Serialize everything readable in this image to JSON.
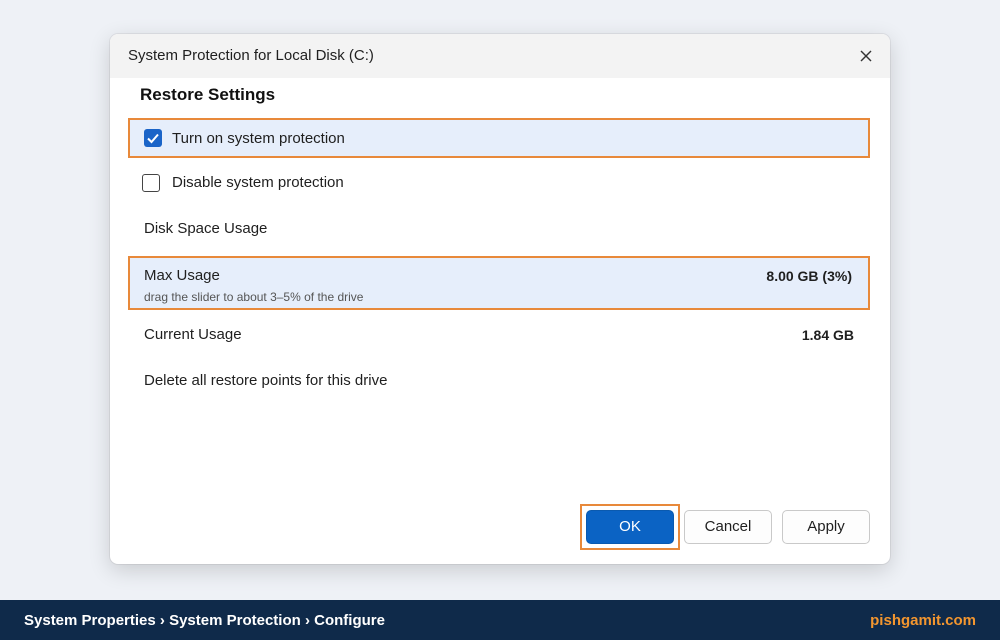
{
  "dialog": {
    "title": "System Protection for Local Disk (C:)",
    "close_icon": "close-icon",
    "section_heading": "Restore Settings",
    "options": {
      "turn_on": {
        "label": "Turn on system protection",
        "checked": true
      },
      "disable": {
        "label": "Disable system protection",
        "checked": false
      }
    },
    "disk_space_heading": "Disk Space Usage",
    "max_usage": {
      "label": "Max Usage",
      "hint": "drag the slider to about 3–5% of the drive",
      "value": "8.00 GB (3%)"
    },
    "current_usage": {
      "label": "Current Usage",
      "value": "1.84 GB"
    },
    "delete_label": "Delete all restore points for this drive",
    "buttons": {
      "ok": "OK",
      "cancel": "Cancel",
      "apply": "Apply"
    }
  },
  "footer": {
    "breadcrumb": [
      "System Properties",
      "System Protection",
      "Configure"
    ],
    "separator": "›",
    "brand": "pishgamit.com"
  },
  "colors": {
    "accent": "#0b63c4",
    "highlight_border": "#e8893a",
    "highlight_fill": "#e6eefb",
    "footer_bg": "#0f2a4a",
    "brand": "#f3962f"
  }
}
